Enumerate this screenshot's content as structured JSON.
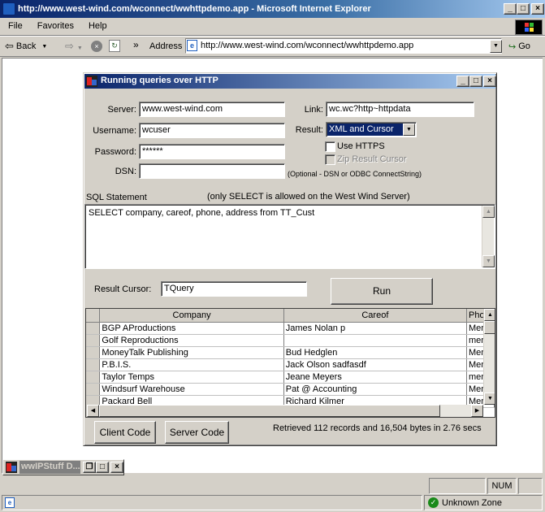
{
  "browser": {
    "title": "http://www.west-wind.com/wconnect/wwhttpdemo.app - Microsoft Internet Explorer",
    "menu": [
      "File",
      "Favorites",
      "Help"
    ],
    "back_label": "Back",
    "address_label": "Address",
    "address_value": "http://www.west-wind.com/wconnect/wwhttpdemo.app",
    "go_label": "Go",
    "more_glyph": "»"
  },
  "form": {
    "title": "Running queries over HTTP",
    "server_label": "Server:",
    "server_value": "www.west-wind.com",
    "username_label": "Username:",
    "username_value": "wcuser",
    "password_label": "Password:",
    "password_value": "******",
    "dsn_label": "DSN:",
    "dsn_value": "",
    "link_label": "Link:",
    "link_value": "wc.wc?http~httpdata",
    "result_label": "Result:",
    "result_value": "XML and Cursor",
    "use_https_label": "Use HTTPS",
    "zip_label": "Zip Result Cursor",
    "dsn_hint": "(Optional - DSN or ODBC ConnectString)",
    "sql_label": "SQL Statement",
    "sql_hint": "(only SELECT is allowed on the West Wind Server)",
    "sql_value": "SELECT company, careof, phone, address from TT_Cust",
    "result_cursor_label": "Result Cursor:",
    "result_cursor_value": "TQuery",
    "run_label": "Run",
    "client_code_label": "Client Code",
    "server_code_label": "Server Code",
    "status_text": "Retrieved 112 records and  16,504 bytes in   2.76 secs"
  },
  "grid": {
    "columns": [
      "Company",
      "Careof",
      "Pho"
    ],
    "rows": [
      [
        "BGP AProductions",
        "James Nolan  p",
        "Men"
      ],
      [
        "Golf Reproductions",
        "",
        "men"
      ],
      [
        "MoneyTalk Publishing",
        "Bud Hedglen",
        "Men"
      ],
      [
        "P.B.I.S.",
        "Jack Olson sadfasdf",
        "Men"
      ],
      [
        "Taylor Temps",
        "Jeane Meyers",
        "men"
      ],
      [
        "Windsurf Warehouse",
        "Pat @ Accounting",
        "Men"
      ],
      [
        "Packard Bell",
        "Richard Kilmer",
        "Men"
      ]
    ]
  },
  "taskbar": {
    "minimized_label": "wwIPStuff D..."
  },
  "statusbar": {
    "num_label": "NUM",
    "zone_label": "Unknown Zone"
  }
}
